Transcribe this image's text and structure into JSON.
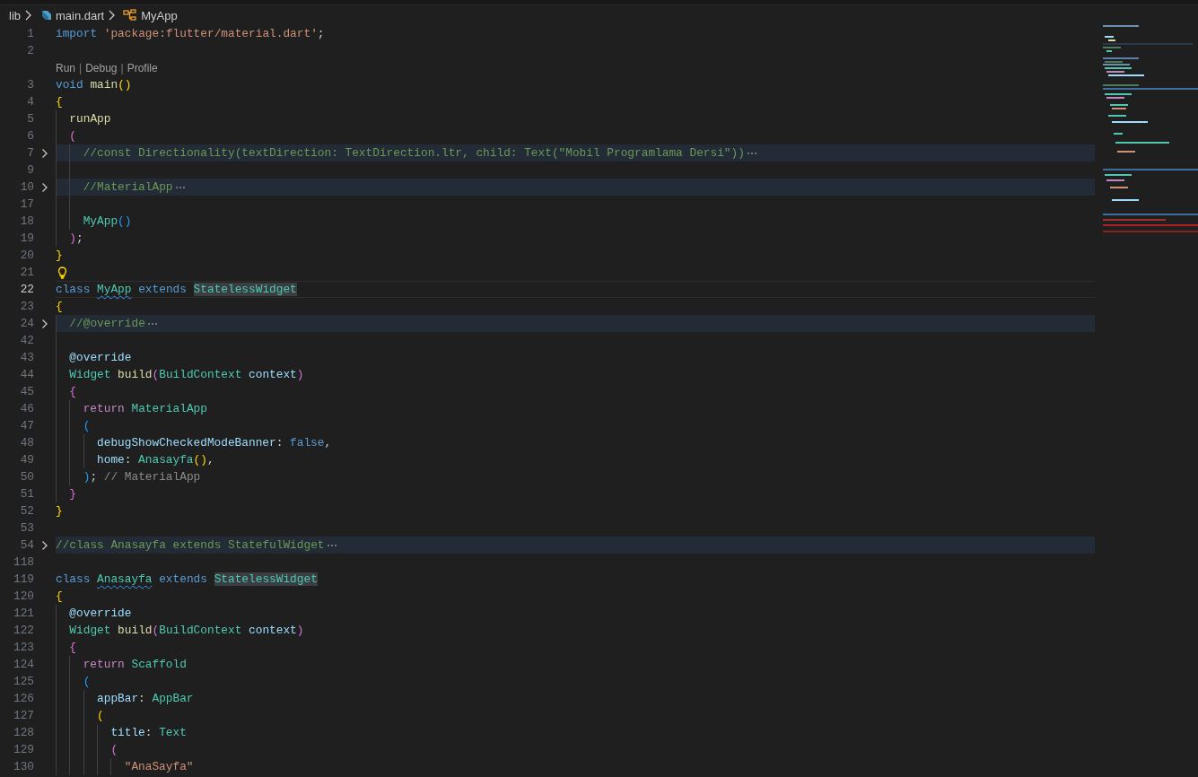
{
  "breadcrumbs": [
    {
      "text": "lib",
      "kind": "folder"
    },
    {
      "text": "main.dart",
      "kind": "file"
    },
    {
      "text": "MyApp",
      "kind": "symbol"
    }
  ],
  "lines": [
    {
      "kind": "code",
      "number": "1",
      "folded": false,
      "current": false,
      "tokens": [
        {
          "kind": "keyword",
          "text": "import "
        },
        {
          "kind": "string",
          "text": "'package:flutter/material.dart'"
        },
        {
          "kind": "plain",
          "text": ";"
        }
      ]
    },
    {
      "kind": "code",
      "number": "2",
      "folded": false,
      "current": false
    },
    {
      "kind": "lens",
      "items": [
        {
          "kind": "link",
          "text": "Run"
        },
        {
          "kind": "separator",
          "text": "|"
        },
        {
          "kind": "link",
          "text": "Debug"
        },
        {
          "kind": "separator",
          "text": "|"
        },
        {
          "kind": "link",
          "text": "Profile"
        }
      ]
    },
    {
      "kind": "code",
      "number": "3",
      "folded": false,
      "current": false,
      "tokens": [
        {
          "kind": "keyword",
          "text": "void "
        },
        {
          "kind": "func",
          "text": "main"
        },
        {
          "kind": "bracket1",
          "text": "()"
        }
      ]
    },
    {
      "kind": "code",
      "number": "4",
      "folded": false,
      "current": false,
      "tokens": [
        {
          "kind": "bracket1",
          "text": "{"
        }
      ],
      "children": [
        {
          "kind": "code",
          "number": "5",
          "folded": false,
          "current": false,
          "tokens": [
            {
              "kind": "func",
              "text": "runApp"
            }
          ]
        },
        {
          "kind": "code",
          "number": "6",
          "folded": false,
          "current": false,
          "tokens": [
            {
              "kind": "bracket2",
              "text": "("
            }
          ],
          "children": [
            {
              "kind": "code",
              "number": "7",
              "folded": true,
              "current": false,
              "tokens": [
                {
                  "kind": "comment",
                  "text": "//const Directionality(textDirection: TextDirection.ltr, child: Text(\"Mobil Programlama Dersi\"))"
                }
              ]
            },
            {
              "kind": "code",
              "number": "9",
              "folded": false,
              "current": false
            },
            {
              "kind": "code",
              "number": "10",
              "folded": true,
              "current": false,
              "tokens": [
                {
                  "kind": "comment",
                  "text": "//MaterialApp"
                }
              ]
            },
            {
              "kind": "code",
              "number": "17",
              "folded": false,
              "current": false
            },
            {
              "kind": "code",
              "number": "18",
              "folded": false,
              "current": false,
              "tokens": [
                {
                  "kind": "type",
                  "text": "MyApp"
                },
                {
                  "kind": "bracket3",
                  "text": "()"
                }
              ]
            }
          ]
        },
        {
          "kind": "code",
          "number": "19",
          "folded": false,
          "current": false,
          "tokens": [
            {
              "kind": "bracket2",
              "text": ")"
            },
            {
              "kind": "plain",
              "text": ";"
            }
          ]
        }
      ]
    },
    {
      "kind": "code",
      "number": "20",
      "folded": false,
      "current": false,
      "tokens": [
        {
          "kind": "bracket1",
          "text": "}"
        }
      ]
    },
    {
      "kind": "lightbulb",
      "number": "21",
      "folded": false,
      "current": false
    },
    {
      "kind": "code",
      "number": "22",
      "folded": false,
      "current": true,
      "tokens": [
        {
          "kind": "keyword",
          "text": "class "
        },
        {
          "kind": "type-squiggle",
          "text": "MyApp"
        },
        {
          "kind": "keyword",
          "text": " extends "
        },
        {
          "kind": "type-highlight",
          "text": "StatelessWidget"
        }
      ]
    },
    {
      "kind": "code",
      "number": "23",
      "folded": false,
      "current": false,
      "tokens": [
        {
          "kind": "bracket1",
          "text": "{"
        }
      ],
      "children": [
        {
          "kind": "code",
          "number": "24",
          "folded": true,
          "current": false,
          "tokens": [
            {
              "kind": "comment",
              "text": "//@override"
            }
          ]
        },
        {
          "kind": "code",
          "number": "42",
          "folded": false,
          "current": false
        },
        {
          "kind": "code",
          "number": "43",
          "folded": false,
          "current": false,
          "tokens": [
            {
              "kind": "var",
              "text": "@override"
            }
          ]
        },
        {
          "kind": "code",
          "number": "44",
          "folded": false,
          "current": false,
          "tokens": [
            {
              "kind": "type",
              "text": "Widget "
            },
            {
              "kind": "func",
              "text": "build"
            },
            {
              "kind": "bracket2",
              "text": "("
            },
            {
              "kind": "type",
              "text": "BuildContext "
            },
            {
              "kind": "var",
              "text": "context"
            },
            {
              "kind": "bracket2",
              "text": ")"
            }
          ]
        },
        {
          "kind": "code",
          "number": "45",
          "folded": false,
          "current": false,
          "tokens": [
            {
              "kind": "bracket2",
              "text": "{"
            }
          ],
          "children": [
            {
              "kind": "code",
              "number": "46",
              "folded": false,
              "current": false,
              "tokens": [
                {
                  "kind": "control",
                  "text": "return "
                },
                {
                  "kind": "type",
                  "text": "MaterialApp"
                }
              ]
            },
            {
              "kind": "code",
              "number": "47",
              "folded": false,
              "current": false,
              "tokens": [
                {
                  "kind": "bracket3",
                  "text": "("
                }
              ],
              "children": [
                {
                  "kind": "code",
                  "number": "48",
                  "folded": false,
                  "current": false,
                  "tokens": [
                    {
                      "kind": "var",
                      "text": "debugShowCheckedModeBanner"
                    },
                    {
                      "kind": "plain",
                      "text": ": "
                    },
                    {
                      "kind": "keyword",
                      "text": "false"
                    },
                    {
                      "kind": "plain",
                      "text": ","
                    }
                  ]
                },
                {
                  "kind": "code",
                  "number": "49",
                  "folded": false,
                  "current": false,
                  "tokens": [
                    {
                      "kind": "var",
                      "text": "home"
                    },
                    {
                      "kind": "plain",
                      "text": ": "
                    },
                    {
                      "kind": "type",
                      "text": "Anasayfa"
                    },
                    {
                      "kind": "bracket1",
                      "text": "()"
                    },
                    {
                      "kind": "plain",
                      "text": ","
                    }
                  ]
                }
              ]
            },
            {
              "kind": "code",
              "number": "50",
              "folded": false,
              "current": false,
              "tokens": [
                {
                  "kind": "bracket3",
                  "text": ")"
                },
                {
                  "kind": "plain",
                  "text": "; "
                },
                {
                  "kind": "hint",
                  "text": "// MaterialApp"
                }
              ]
            }
          ]
        },
        {
          "kind": "code",
          "number": "51",
          "folded": false,
          "current": false,
          "tokens": [
            {
              "kind": "bracket2",
              "text": "}"
            }
          ]
        }
      ]
    },
    {
      "kind": "code",
      "number": "52",
      "folded": false,
      "current": false,
      "tokens": [
        {
          "kind": "bracket1",
          "text": "}"
        }
      ]
    },
    {
      "kind": "code",
      "number": "53",
      "folded": false,
      "current": false
    },
    {
      "kind": "code",
      "number": "54",
      "folded": true,
      "current": false,
      "tokens": [
        {
          "kind": "comment",
          "text": "//class Anasayfa extends StatefulWidget"
        }
      ]
    },
    {
      "kind": "code",
      "number": "118",
      "folded": false,
      "current": false
    },
    {
      "kind": "code",
      "number": "119",
      "folded": false,
      "current": false,
      "tokens": [
        {
          "kind": "keyword",
          "text": "class "
        },
        {
          "kind": "type-squiggle",
          "text": "Anasayfa"
        },
        {
          "kind": "keyword",
          "text": " extends "
        },
        {
          "kind": "type-highlight",
          "text": "StatelessWidget"
        }
      ]
    },
    {
      "kind": "code",
      "number": "120",
      "folded": false,
      "current": false,
      "tokens": [
        {
          "kind": "bracket1",
          "text": "{"
        }
      ],
      "children": [
        {
          "kind": "code",
          "number": "121",
          "folded": false,
          "current": false,
          "tokens": [
            {
              "kind": "var",
              "text": "@override"
            }
          ]
        },
        {
          "kind": "code",
          "number": "122",
          "folded": false,
          "current": false,
          "tokens": [
            {
              "kind": "type",
              "text": "Widget "
            },
            {
              "kind": "func",
              "text": "build"
            },
            {
              "kind": "bracket2",
              "text": "("
            },
            {
              "kind": "type",
              "text": "BuildContext "
            },
            {
              "kind": "var",
              "text": "context"
            },
            {
              "kind": "bracket2",
              "text": ")"
            }
          ]
        },
        {
          "kind": "code",
          "number": "123",
          "folded": false,
          "current": false,
          "tokens": [
            {
              "kind": "bracket2",
              "text": "{"
            }
          ],
          "children": [
            {
              "kind": "code",
              "number": "124",
              "folded": false,
              "current": false,
              "tokens": [
                {
                  "kind": "control",
                  "text": "return "
                },
                {
                  "kind": "type",
                  "text": "Scaffold"
                }
              ]
            },
            {
              "kind": "code",
              "number": "125",
              "folded": false,
              "current": false,
              "tokens": [
                {
                  "kind": "bracket3",
                  "text": "("
                }
              ],
              "children": [
                {
                  "kind": "code",
                  "number": "126",
                  "folded": false,
                  "current": false,
                  "tokens": [
                    {
                      "kind": "var",
                      "text": "appBar"
                    },
                    {
                      "kind": "plain",
                      "text": ": "
                    },
                    {
                      "kind": "type",
                      "text": "AppBar"
                    }
                  ]
                },
                {
                  "kind": "code",
                  "number": "127",
                  "folded": false,
                  "current": false,
                  "tokens": [
                    {
                      "kind": "bracket1",
                      "text": "("
                    }
                  ],
                  "children": [
                    {
                      "kind": "code",
                      "number": "128",
                      "folded": false,
                      "current": false,
                      "tokens": [
                        {
                          "kind": "var",
                          "text": "title"
                        },
                        {
                          "kind": "plain",
                          "text": ": "
                        },
                        {
                          "kind": "type",
                          "text": "Text"
                        }
                      ]
                    },
                    {
                      "kind": "code",
                      "number": "129",
                      "folded": false,
                      "current": false,
                      "tokens": [
                        {
                          "kind": "bracket2",
                          "text": "("
                        }
                      ],
                      "children": [
                        {
                          "kind": "code",
                          "number": "130",
                          "folded": false,
                          "current": false,
                          "tokens": [
                            {
                              "kind": "string",
                              "text": "\"AnaSayfa\""
                            }
                          ]
                        }
                      ]
                    }
                  ]
                }
              ]
            }
          ]
        }
      ]
    }
  ]
}
